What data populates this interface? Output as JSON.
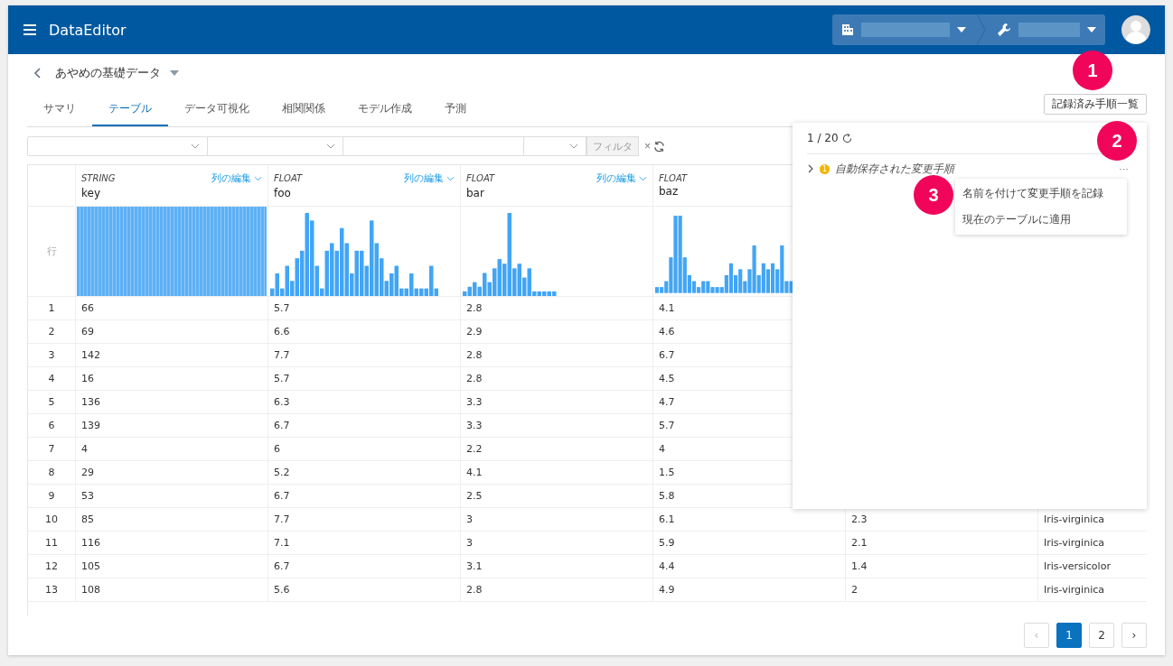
{
  "app_bar": {
    "title": "DataEditor"
  },
  "page": {
    "title": "あやめの基礎データ"
  },
  "tabs": [
    {
      "label": "サマリ",
      "selected": false
    },
    {
      "label": "テーブル",
      "selected": true
    },
    {
      "label": "データ可視化",
      "selected": false
    },
    {
      "label": "相関関係",
      "selected": false
    },
    {
      "label": "モデル作成",
      "selected": false
    },
    {
      "label": "予測",
      "selected": false
    }
  ],
  "recorded_steps_button": "記録済み手順一覧",
  "filter_bar": {
    "button": "フィルタ",
    "clear": "×"
  },
  "table": {
    "row_header": "行",
    "columns": [
      {
        "type": "STRING",
        "name": "key",
        "edit_label": "列の編集"
      },
      {
        "type": "FLOAT",
        "name": "foo",
        "edit_label": "列の編集"
      },
      {
        "type": "FLOAT",
        "name": "bar",
        "edit_label": "列の編集"
      },
      {
        "type": "FLOAT",
        "name": "baz"
      }
    ],
    "rows": [
      {
        "index": "1",
        "cells": [
          "66",
          "5.7",
          "2.8",
          "4.1"
        ]
      },
      {
        "index": "2",
        "cells": [
          "69",
          "6.6",
          "2.9",
          "4.6"
        ]
      },
      {
        "index": "3",
        "cells": [
          "142",
          "7.7",
          "2.8",
          "6.7"
        ]
      },
      {
        "index": "4",
        "cells": [
          "16",
          "5.7",
          "2.8",
          "4.5"
        ]
      },
      {
        "index": "5",
        "cells": [
          "136",
          "6.3",
          "3.3",
          "4.7"
        ]
      },
      {
        "index": "6",
        "cells": [
          "139",
          "6.7",
          "3.3",
          "5.7"
        ]
      },
      {
        "index": "7",
        "cells": [
          "4",
          "6",
          "2.2",
          "4"
        ]
      },
      {
        "index": "8",
        "cells": [
          "29",
          "5.2",
          "4.1",
          "1.5"
        ]
      },
      {
        "index": "9",
        "cells": [
          "53",
          "6.7",
          "2.5",
          "5.8"
        ]
      },
      {
        "index": "10",
        "cells": [
          "85",
          "7.7",
          "3",
          "6.1",
          "2.3",
          "Iris-virginica"
        ]
      },
      {
        "index": "11",
        "cells": [
          "116",
          "7.1",
          "3",
          "5.9",
          "2.1",
          "Iris-virginica"
        ]
      },
      {
        "index": "12",
        "cells": [
          "105",
          "6.7",
          "3.1",
          "4.4",
          "1.4",
          "Iris-versicolor"
        ]
      },
      {
        "index": "13",
        "cells": [
          "108",
          "5.6",
          "2.8",
          "4.9",
          "2",
          "Iris-virginica"
        ]
      }
    ]
  },
  "steps_panel": {
    "counter": "1 / 20",
    "items": [
      {
        "title": "自動保存された変更手順",
        "badge": "1",
        "expanded": false,
        "more": "···"
      }
    ],
    "menu": [
      "名前を付けて変更手順を記録",
      "現在のテーブルに適用"
    ]
  },
  "pagination": {
    "prev": "‹",
    "next": "›",
    "pages": [
      {
        "label": "1",
        "selected": true
      },
      {
        "label": "2",
        "selected": false
      }
    ]
  },
  "callouts": [
    "1",
    "2",
    "3"
  ]
}
